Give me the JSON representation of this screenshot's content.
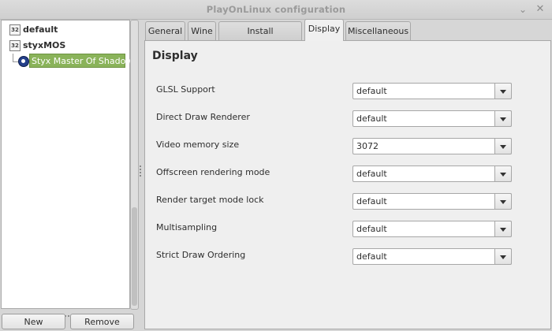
{
  "window": {
    "title": "PlayOnLinux configuration",
    "minimize_glyph": "⌄",
    "close_glyph": "✕"
  },
  "tree": {
    "items": [
      {
        "label": "default",
        "icon": "32"
      },
      {
        "label": "styxMOS",
        "icon": "32"
      }
    ],
    "child": {
      "label": "Styx Master Of Shadows",
      "icon": "steam-icon"
    }
  },
  "buttons": {
    "new": "New",
    "remove": "Remove"
  },
  "tabs": [
    "General",
    "Wine",
    "Install components",
    "Display",
    "Miscellaneous"
  ],
  "active_tab": "Display",
  "panel": {
    "title": "Display",
    "settings": [
      {
        "label": "GLSL Support",
        "value": "default"
      },
      {
        "label": "Direct Draw Renderer",
        "value": "default"
      },
      {
        "label": "Video memory size",
        "value": "3072"
      },
      {
        "label": "Offscreen rendering mode",
        "value": "default"
      },
      {
        "label": "Render target mode lock",
        "value": "default"
      },
      {
        "label": "Multisampling",
        "value": "default"
      },
      {
        "label": "Strict Draw Ordering",
        "value": "default"
      }
    ]
  },
  "colors": {
    "selection": "#8ab35a",
    "background": "#d6d6d6",
    "panel": "#efefef"
  }
}
